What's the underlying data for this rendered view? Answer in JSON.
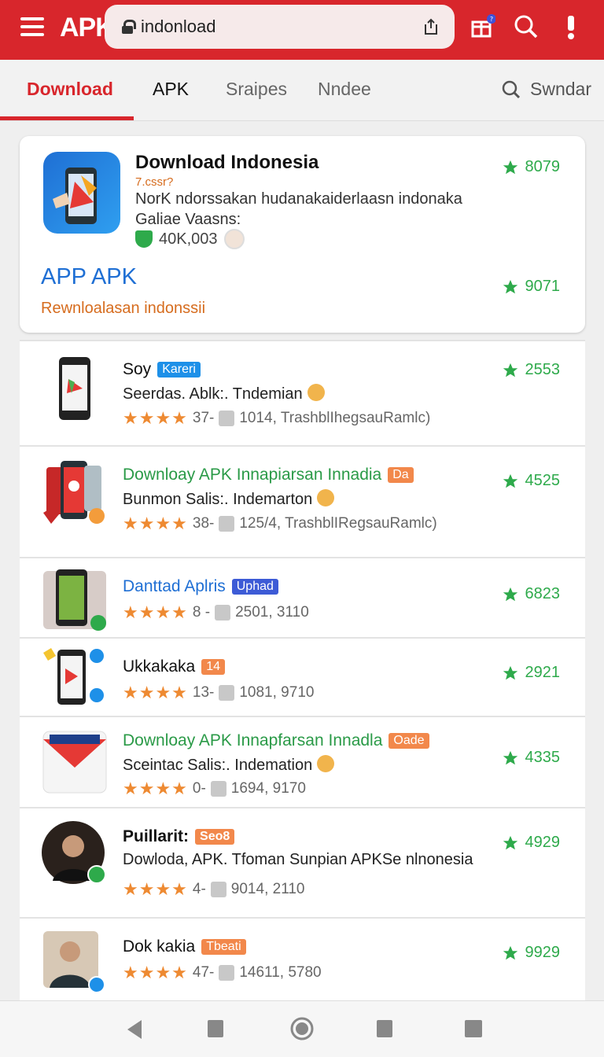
{
  "header": {
    "brand": "APK",
    "url": "indonload",
    "accent": "#d8262c",
    "notification_badge": "?"
  },
  "tabs": [
    {
      "label": "Download"
    },
    {
      "label": "APK"
    },
    {
      "label": "Sraipes"
    },
    {
      "label": "Nndee"
    },
    {
      "label": "Swndar"
    }
  ],
  "featured": {
    "title": "Download Indonesia",
    "subtitle": "7.cssr?",
    "description_1": "NorK ndorssakan hudanakaiderlaasn indonaka",
    "description_2": "Galiae Vaasns:",
    "downloads": "40K,003",
    "rating": "8079",
    "section_heading": "APP APK",
    "section_link": "Rewnloalasan indonssii",
    "section_rating": "9071"
  },
  "apps": [
    {
      "name": "Soy",
      "badge": "Kareri",
      "desc": "Seerdas. Ablk:. Tndemian",
      "stars_count": "37-",
      "meta": "1014, TrashblIhegsauRamlc)",
      "rating": "2553"
    },
    {
      "name": "Downloay APK Innapiarsan Innadia",
      "badge": "Da",
      "desc": "Bunmon Salis:. Indemarton",
      "stars_count": "38-",
      "meta": "125/4, TrashblIRegsauRamlc)",
      "rating": "4525"
    },
    {
      "name": "Danttad Aplris",
      "badge": "Uphad",
      "desc": "",
      "stars_count": "8 -",
      "meta": "2501, 3110",
      "rating": "6823"
    },
    {
      "name": "Ukkakaka",
      "badge": "14",
      "desc": "",
      "stars_count": "13-",
      "meta": "1081, 9710",
      "rating": "2921"
    },
    {
      "name": "Downloay APK Innapfarsan Innadla",
      "badge": "Oade",
      "desc": "Sceintac Salis:. Indemation",
      "stars_count": "0-",
      "meta": "1694, 9170",
      "rating": "4335"
    },
    {
      "name": "Puillarit:",
      "badge": "Seo8",
      "desc": "Dowloda, APK. Tfoman Sunpian APKSe nlnonesia",
      "stars_count": "4-",
      "meta": "9014, 2110",
      "rating": "4929"
    },
    {
      "name": "Dok kakia",
      "badge": "Tbeati",
      "desc": "",
      "stars_count": "47-",
      "meta": "14611, 5780",
      "rating": "9929"
    }
  ],
  "stars": "★★★★"
}
